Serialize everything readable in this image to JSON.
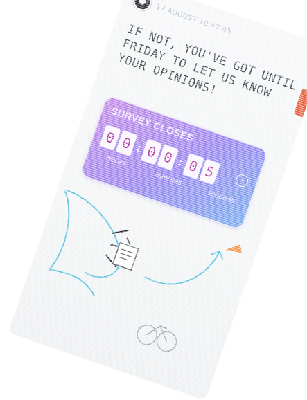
{
  "story": {
    "handle": "17 AUGUST 10:47:45"
  },
  "headline": "IF NOT, YOU'VE GOT UNTIL FRIDAY TO LET US KNOW YOUR OPINIONS!",
  "countdown": {
    "title": "SURVEY CLOSES",
    "digits": {
      "hours": [
        "0",
        "0"
      ],
      "minutes": [
        "0",
        "0"
      ],
      "seconds": [
        "0",
        "5"
      ]
    },
    "units": [
      "hours",
      "minutes",
      "seconds"
    ],
    "accent": "#b43fa6"
  },
  "icons": {
    "avatar": "profile-avatar",
    "arrow": "arrow-right-icon",
    "megaphone": "megaphone-icon",
    "survey": "clipboard-icon",
    "side_sticker": "sticker-icon"
  }
}
